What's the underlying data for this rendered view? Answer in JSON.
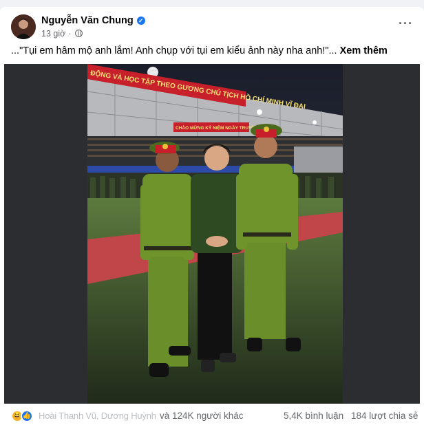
{
  "post": {
    "author": "Nguyễn Văn Chung",
    "time": "13 giờ",
    "text_prefix": "...\"Tụi em hâm mộ anh lắm! Anh chụp với tụi em kiểu ảnh này nha anh!\"... ",
    "see_more": "Xem thêm",
    "more_label": "···",
    "verified_icon": "verified-badge-icon",
    "privacy_icon": "globe-icon"
  },
  "stadium": {
    "banner_top": "ĐỘNG VÀ HỌC TẬP THEO GƯƠNG CHỦ TỊCH HỒ CHÍ MINH VĨ ĐẠI",
    "banner_mid": "CHÀO MỪNG KỶ NIỆM NGÀY TRUYỀN THỐNG"
  },
  "footer": {
    "reaction_icons": [
      "haha-icon",
      "like-icon"
    ],
    "reactor_names": "Hoài Thanh Vũ, Dương Huỳnh Hương",
    "others_text": "và 124K người khác",
    "comments": "5,4K bình luận",
    "shares": "184 lượt chia sẻ"
  },
  "colors": {
    "facebook_blue": "#1877f2",
    "uniform_green": "#6a8f2a",
    "banner_red": "#c8202a"
  }
}
